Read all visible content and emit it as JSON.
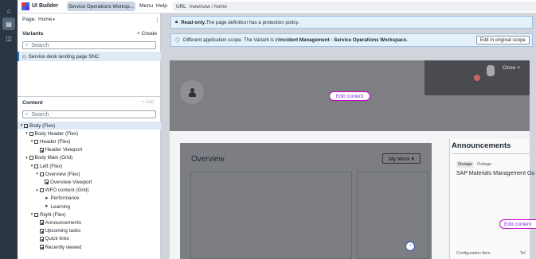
{
  "app": {
    "title": "UI Builder",
    "workspace_tab": "Service Operations Worksp...",
    "menu_label": "Menu",
    "help_label": "Help",
    "url_label": "URL",
    "url_value": "/now/sow / home"
  },
  "page_selector": {
    "label": "Page:",
    "value": "Home"
  },
  "variants": {
    "heading": "Variants",
    "create_label": "+ Create",
    "search_placeholder": "Search",
    "items": [
      "Service desk landing page SNC"
    ]
  },
  "content": {
    "heading": "Content",
    "add_label": "+ Add",
    "search_placeholder": "Search"
  },
  "tree": [
    {
      "label": "Body (Flex)"
    },
    {
      "label": "Body Header (Flex)"
    },
    {
      "label": "Header (Flex)"
    },
    {
      "label": "Header Viewport"
    },
    {
      "label": "Body Main (Grid)"
    },
    {
      "label": "Left (Flex)"
    },
    {
      "label": "Overview (Flex)"
    },
    {
      "label": "Overview Viewport"
    },
    {
      "label": "WFO content (Grid)"
    },
    {
      "label": "Performance"
    },
    {
      "label": "Learning"
    },
    {
      "label": "Right (Flex)"
    },
    {
      "label": "Announcements"
    },
    {
      "label": "Upcoming tasks"
    },
    {
      "label": "Quick links"
    },
    {
      "label": "Recently viewed"
    }
  ],
  "banners": {
    "readonly_strong": "Read-only.",
    "readonly_text": " The page definition has a protection policy.",
    "scope_text": "Different application scope. The Variant is in ",
    "scope_strong": "Incident Management - Service Operations Workspace.",
    "scope_button": "Edit in original scope"
  },
  "canvas": {
    "edit_content": "Edit content",
    "close_label": "Close ×",
    "overview_title": "Overview",
    "my_work_label": "My Work ▾",
    "announcements_title": "Announcements",
    "outage_badge": "Outage",
    "outage_text": "Outage",
    "announcement_item": "SAP Materials Management Ou",
    "config_label": "Configuration Item",
    "tel_label": "Tel"
  },
  "colors": {
    "accent": "#cc00cc",
    "rail": "#2c3542",
    "selected": "#dfe9f4"
  }
}
